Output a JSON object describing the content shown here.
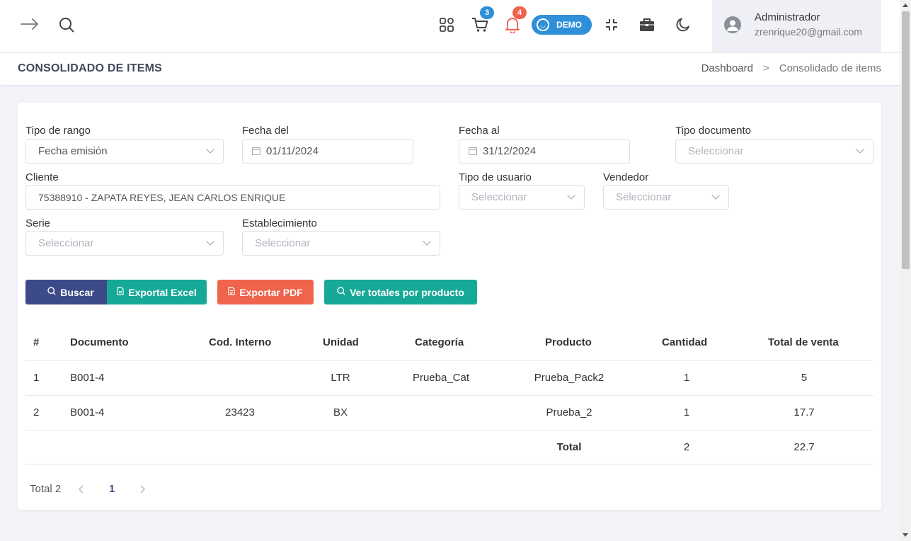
{
  "header": {
    "notifications": {
      "cart_count": "3",
      "bell_count": "4"
    },
    "demo_label": "DEMO",
    "user": {
      "name": "Administrador",
      "email": "zrenrique20@gmail.com"
    },
    "colors": {
      "cart_badge": "#2f8fd8",
      "bell_badge": "#f0644d",
      "demo": "#2f8fd8"
    }
  },
  "titlebar": {
    "title": "CONSOLIDADO DE ITEMS",
    "breadcrumb": [
      "Dashboard",
      ">",
      "Consolidado de items"
    ]
  },
  "filters": {
    "tipo_rango": {
      "label": "Tipo de rango",
      "value": "Fecha emisión"
    },
    "fecha_del": {
      "label": "Fecha del",
      "value": "01/11/2024"
    },
    "fecha_al": {
      "label": "Fecha al",
      "value": "31/12/2024"
    },
    "tipo_documento": {
      "label": "Tipo documento",
      "placeholder": "Seleccionar"
    },
    "cliente": {
      "label": "Cliente",
      "value": "75388910 - ZAPATA REYES, JEAN CARLOS ENRIQUE"
    },
    "tipo_usuario": {
      "label": "Tipo de usuario",
      "placeholder": "Seleccionar"
    },
    "vendedor": {
      "label": "Vendedor",
      "placeholder": "Seleccionar"
    },
    "serie": {
      "label": "Serie",
      "placeholder": "Seleccionar"
    },
    "establecimiento": {
      "label": "Establecimiento",
      "placeholder": "Seleccionar"
    }
  },
  "actions": {
    "buscar": {
      "label": "Buscar",
      "color": "#3d4a8a"
    },
    "excel": {
      "label": "Exportal Excel",
      "color": "#17a997"
    },
    "pdf": {
      "label": "Exportar PDF",
      "color": "#f0644d"
    },
    "totales": {
      "label": "Ver totales por producto",
      "color": "#17a997"
    }
  },
  "table": {
    "headers": [
      "#",
      "Documento",
      "Cod. Interno",
      "Unidad",
      "Categoría",
      "Producto",
      "Cantidad",
      "Total de venta"
    ],
    "rows": [
      [
        "1",
        "B001-4",
        "",
        "LTR",
        "Prueba_Cat",
        "Prueba_Pack2",
        "1",
        "5"
      ],
      [
        "2",
        "B001-4",
        "23423",
        "BX",
        "",
        "Prueba_2",
        "1",
        "17.7"
      ]
    ],
    "footer": {
      "label": "Total",
      "cantidad": "2",
      "total": "22.7"
    }
  },
  "pagination": {
    "total_label": "Total 2",
    "current_page": "1"
  }
}
